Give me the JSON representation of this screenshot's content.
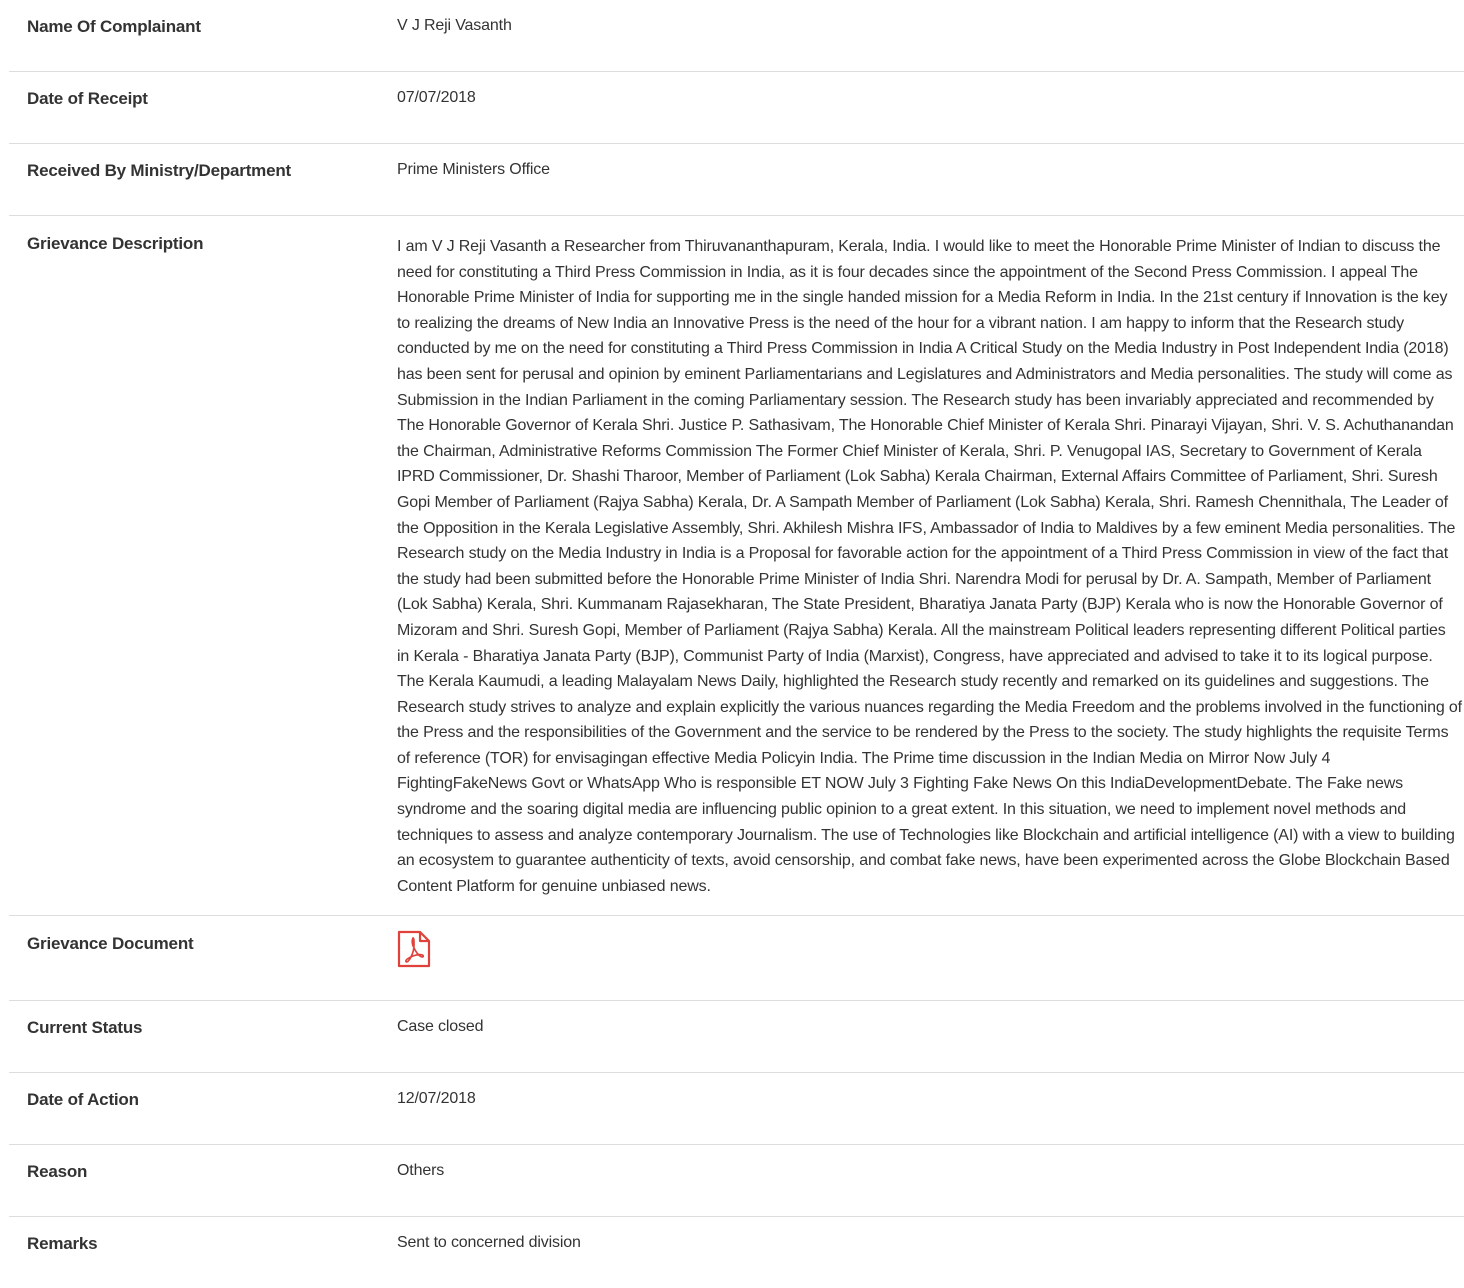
{
  "rows": {
    "complainant": {
      "label": "Name Of Complainant",
      "value": "V J Reji Vasanth"
    },
    "receipt_date": {
      "label": "Date of Receipt",
      "value": "07/07/2018"
    },
    "received_by": {
      "label": "Received By Ministry/Department",
      "value": "Prime Ministers Office"
    },
    "description": {
      "label": "Grievance Description",
      "value": "I am V J Reji Vasanth a Researcher from Thiruvananthapuram, Kerala, India. I would like to meet the Honorable Prime Minister of Indian to discuss the need for constituting a Third Press Commission in India, as it is four decades since the appointment of the Second Press Commission. I appeal The Honorable Prime Minister of India for supporting me in the single handed mission for a Media Reform in India. In the 21st century if Innovation is the key to realizing the dreams of New India an Innovative Press is the need of the hour for a vibrant nation. I am happy to inform that the Research study conducted by me on the need for constituting a Third Press Commission in India A Critical Study on the Media Industry in Post Independent India (2018) has been sent for perusal and opinion by eminent Parliamentarians and Legislatures and Administrators and Media personalities. The study will come as Submission in the Indian Parliament in the coming Parliamentary session. The Research study has been invariably appreciated and recommended by The Honorable Governor of Kerala Shri. Justice P. Sathasivam, The Honorable Chief Minister of Kerala Shri. Pinarayi Vijayan, Shri. V. S. Achuthanandan the Chairman, Administrative Reforms Commission The Former Chief Minister of Kerala, Shri. P. Venugopal IAS, Secretary to Government of Kerala IPRD Commissioner, Dr. Shashi Tharoor, Member of Parliament (Lok Sabha) Kerala Chairman, External Affairs Committee of Parliament, Shri. Suresh Gopi Member of Parliament (Rajya Sabha) Kerala, Dr. A Sampath Member of Parliament (Lok Sabha) Kerala, Shri. Ramesh Chennithala, The Leader of the Opposition in the Kerala Legislative Assembly, Shri. Akhilesh Mishra IFS, Ambassador of India to Maldives by a few eminent Media personalities. The Research study on the Media Industry in India is a Proposal for favorable action for the appointment of a Third Press Commission in view of the fact that the study had been submitted before the Honorable Prime Minister of India Shri. Narendra Modi for perusal by Dr. A. Sampath, Member of Parliament (Lok Sabha) Kerala, Shri. Kummanam Rajasekharan, The State President, Bharatiya Janata Party (BJP) Kerala who is now the Honorable Governor of Mizoram and Shri. Suresh Gopi, Member of Parliament (Rajya Sabha) Kerala. All the mainstream Political leaders representing different Political parties in Kerala - Bharatiya Janata Party (BJP), Communist Party of India (Marxist), Congress, have appreciated and advised to take it to its logical purpose. The Kerala Kaumudi, a leading Malayalam News Daily, highlighted the Research study recently and remarked on its guidelines and suggestions. The Research study strives to analyze and explain explicitly the various nuances regarding the Media Freedom and the problems involved in the functioning of the Press and the responsibilities of the Government and the service to be rendered by the Press to the society. The study highlights the requisite Terms of reference (TOR) for envisagingan effective Media Policyin India. The Prime time discussion in the Indian Media on Mirror Now July 4 FightingFakeNews Govt or WhatsApp Who is responsible ET NOW July 3 Fighting Fake News On this IndiaDevelopmentDebate. The Fake news syndrome and the soaring digital media are influencing public opinion to a great extent. In this situation, we need to implement novel methods and techniques to assess and analyze contemporary Journalism. The use of Technologies like Blockchain and artificial intelligence (AI) with a view to building an ecosystem to guarantee authenticity of texts, avoid censorship, and combat fake news, have been experimented across the Globe Blockchain Based Content Platform for genuine unbiased news."
    },
    "document": {
      "label": "Grievance Document",
      "icon": "pdf-file-icon",
      "icon_color": "#e0413a"
    },
    "status": {
      "label": "Current Status",
      "value": "Case closed"
    },
    "action_date": {
      "label": "Date of Action",
      "value": "12/07/2018"
    },
    "reason": {
      "label": "Reason",
      "value": "Others"
    },
    "remarks": {
      "label": "Remarks",
      "value": "Sent to concerned division"
    }
  },
  "colors": {
    "text": "#333333",
    "divider": "#dddddd",
    "pdf_icon": "#e0413a"
  }
}
